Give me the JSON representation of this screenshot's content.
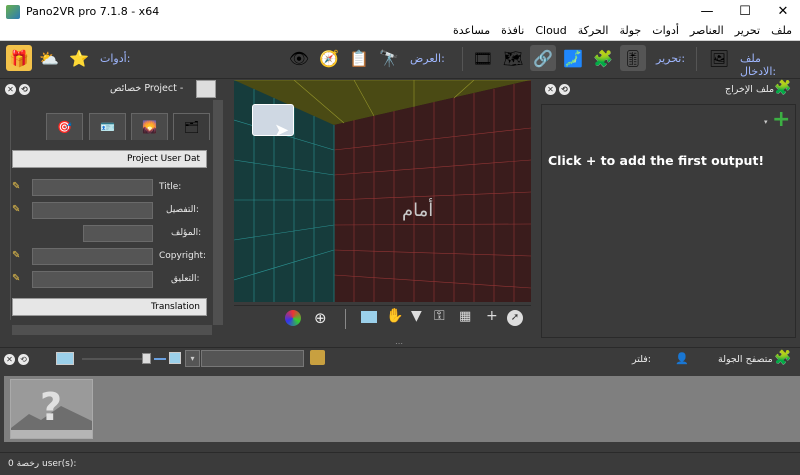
{
  "window": {
    "title": "Pano2VR pro 7.1.8 - x64",
    "minimize": "—",
    "maximize": "☐",
    "close": "✕"
  },
  "menu": [
    "ملف",
    "تحرير",
    "العناصر",
    "أدوات",
    "جولة",
    "الحركة",
    "Cloud",
    "نافذة",
    "مساعدة"
  ],
  "toolbar": {
    "input_file_label": "ملف الادخال:",
    "edit_label": "تحرير:",
    "view_label": "العرض:",
    "tools_label": "أدوات:"
  },
  "left_panel": {
    "title": "خصائص Project -",
    "section_user_data": "Project User Dat",
    "section_translation": "Translation",
    "fields": {
      "title_label": "Title:",
      "description_label": "التفصيل:",
      "author_label": "المؤلف:",
      "copyright_label": "Copyright:",
      "comment_label": "التعليق:"
    }
  },
  "viewer": {
    "front_label": "أمام"
  },
  "right_panel": {
    "title": "ملف الإخراج",
    "empty_message": "Click + to add the first output!"
  },
  "tour_browser": {
    "title": "متصفح الجولة",
    "filter_label": "فلتر:"
  },
  "status": {
    "text": "رخصة 0 user(s):"
  },
  "colors": {
    "accent_label": "#9fb7ff",
    "panel_bg": "#3b3b3b",
    "add_button": "#3cb043"
  }
}
